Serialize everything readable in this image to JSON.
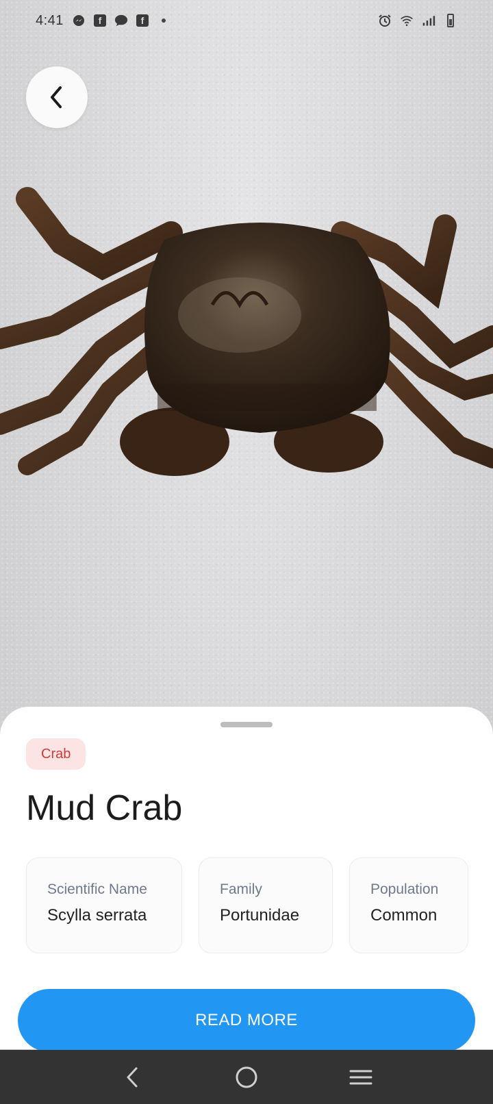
{
  "status_bar": {
    "time": "4:41",
    "left_icons": [
      "messenger-icon",
      "facebook-icon",
      "chat-bubble-icon",
      "facebook-icon",
      "dot-icon"
    ],
    "right_icons": [
      "alarm-icon",
      "wifi-icon",
      "signal-icon",
      "battery-icon"
    ]
  },
  "header": {
    "back_icon": "chevron-left-icon"
  },
  "species": {
    "category": "Crab",
    "name": "Mud Crab",
    "details": [
      {
        "label": "Scientific Name",
        "value": "Scylla serrata"
      },
      {
        "label": "Family",
        "value": "Portunidae"
      },
      {
        "label": "Population",
        "value": "Common"
      }
    ]
  },
  "actions": {
    "read_more_label": "READ MORE"
  },
  "navigation": {
    "icons": [
      "back-icon",
      "home-icon",
      "recents-icon"
    ]
  },
  "colors": {
    "accent": "#2196F3",
    "tag_bg": "#FDE4E4",
    "tag_text": "#CF3A3A",
    "nav_bar": "#333333"
  }
}
